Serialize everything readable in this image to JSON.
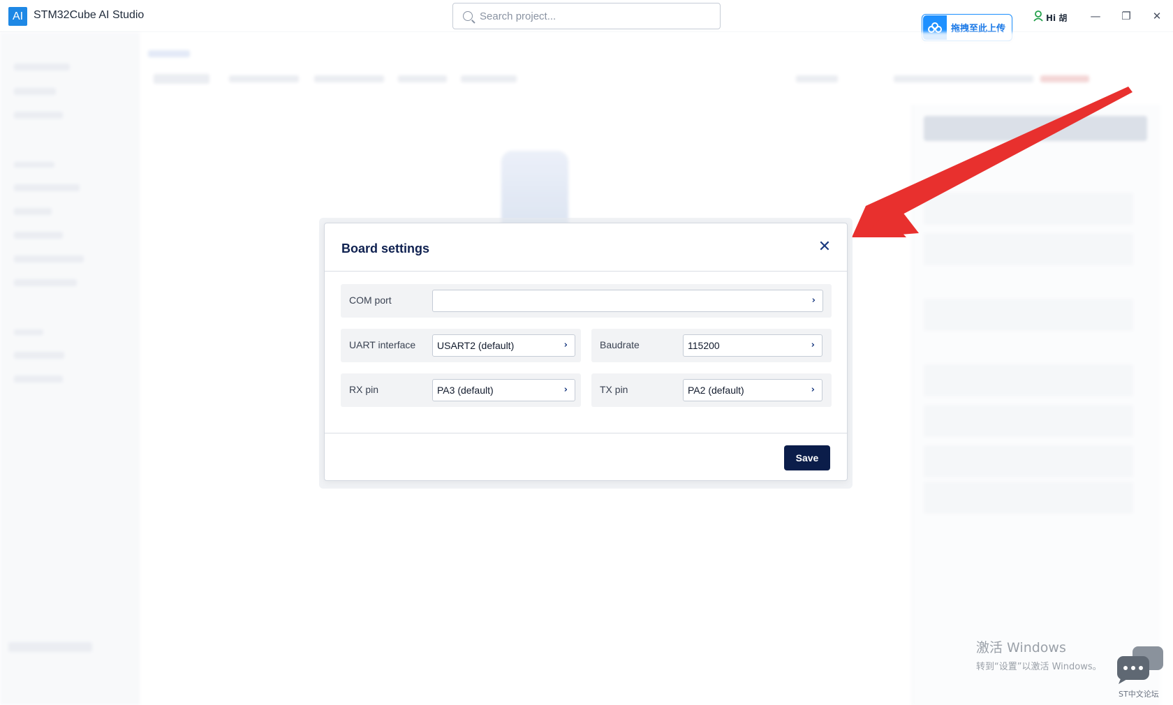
{
  "app": {
    "logo": "AI",
    "title": "STM32Cube AI Studio"
  },
  "search": {
    "placeholder": "Search project..."
  },
  "upload_badge": {
    "label": "拖拽至此上传",
    "icon": "cloud-icon"
  },
  "user": {
    "greeting": "Hi 胡",
    "icon": "user-icon"
  },
  "window_controls": {
    "minimize": "—",
    "restore": "❐",
    "close": "✕"
  },
  "modal": {
    "title": "Board settings",
    "close_icon": "✕",
    "fields": {
      "com_port": {
        "label": "COM port",
        "value": ""
      },
      "uart_interface": {
        "label": "UART interface",
        "value": "USART2 (default)"
      },
      "baudrate": {
        "label": "Baudrate",
        "value": "115200"
      },
      "rx_pin": {
        "label": "RX pin",
        "value": "PA3 (default)"
      },
      "tx_pin": {
        "label": "TX pin",
        "value": "PA2 (default)"
      }
    },
    "chevron": "›",
    "save_label": "Save"
  },
  "watermark": {
    "line1": "激活 Windows",
    "line2": "转到“设置”以激活 Windows。"
  },
  "forum": {
    "label": "ST中文论坛"
  },
  "colors": {
    "accent": "#0b1d4a",
    "arrow": "#e8302e",
    "logo_blue": "#1e88e5"
  }
}
